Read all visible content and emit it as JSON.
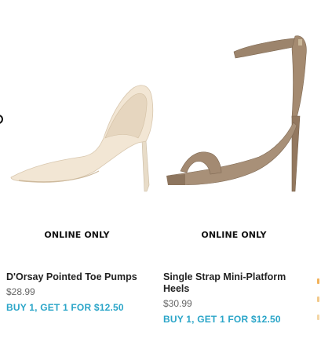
{
  "products": [
    {
      "badge": "ONLINE ONLY",
      "name": "D'Orsay Pointed Toe Pumps",
      "price": "$28.99",
      "promo": "BUY 1, GET 1 FOR $12.50",
      "image_description_icon": "nude-pump-shoe-image"
    },
    {
      "badge": "ONLINE ONLY",
      "name": "Single Strap Mini-Platform Heels",
      "price": "$30.99",
      "promo": "BUY 1, GET 1 FOR $12.50",
      "image_description_icon": "taupe-sandal-heel-image"
    }
  ],
  "colors": {
    "promo": "#2aa5c8",
    "price": "#666666",
    "name": "#222222"
  }
}
